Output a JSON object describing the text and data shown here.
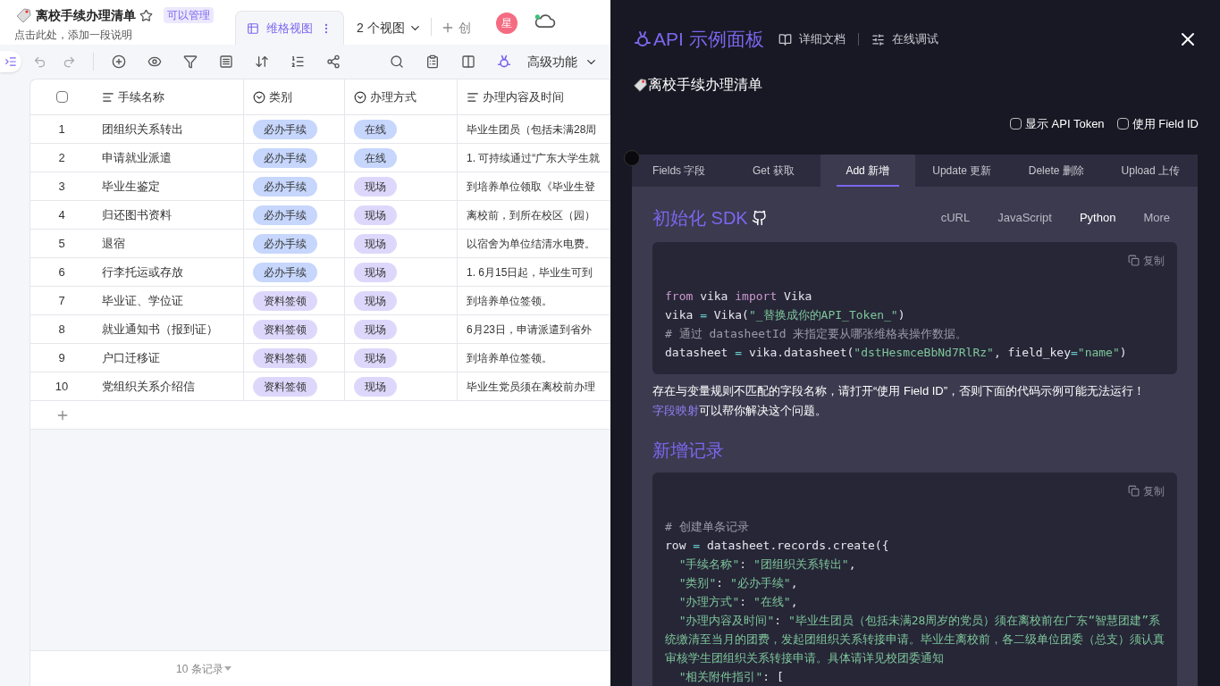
{
  "sheet": {
    "title": "离校手续办理清单",
    "permission": "可以管理",
    "description": "点击此处，添加一段说明"
  },
  "view_tab": {
    "label": "维格视图",
    "selected": true
  },
  "views_menu": {
    "label": "2 个视图"
  },
  "create_button": {
    "label": "创"
  },
  "avatar": {
    "initial": "星"
  },
  "toolbar": {
    "advanced": "高级功能"
  },
  "table": {
    "select_all": {
      "checked": false
    },
    "columns": [
      {
        "label": "手续名称",
        "kind": "text"
      },
      {
        "label": "类别",
        "kind": "select"
      },
      {
        "label": "办理方式",
        "kind": "select"
      },
      {
        "label": "办理内容及时间",
        "kind": "text"
      }
    ],
    "rows": [
      {
        "index": "1",
        "name": "团组织关系转出",
        "category": {
          "label": "必办手续",
          "color": "#c6d6fc"
        },
        "method": {
          "label": "在线",
          "color": "#c6d6fc"
        },
        "content": "毕业生团员（包括未满28周"
      },
      {
        "index": "2",
        "name": "申请就业派遣",
        "category": {
          "label": "必办手续",
          "color": "#c6d6fc"
        },
        "method": {
          "label": "在线",
          "color": "#c6d6fc"
        },
        "content": "1. 可持续通过“广东大学生就"
      },
      {
        "index": "3",
        "name": "毕业生鉴定",
        "category": {
          "label": "必办手续",
          "color": "#c6d6fc"
        },
        "method": {
          "label": "现场",
          "color": "#ddd8fb"
        },
        "content": "到培养单位领取《毕业生登"
      },
      {
        "index": "4",
        "name": "归还图书资料",
        "category": {
          "label": "必办手续",
          "color": "#c6d6fc"
        },
        "method": {
          "label": "现场",
          "color": "#ddd8fb"
        },
        "content": "离校前，到所在校区（园）"
      },
      {
        "index": "5",
        "name": "退宿",
        "category": {
          "label": "必办手续",
          "color": "#c6d6fc"
        },
        "method": {
          "label": "现场",
          "color": "#ddd8fb"
        },
        "content": "以宿舍为单位结清水电费。"
      },
      {
        "index": "6",
        "name": "行李托运或存放",
        "category": {
          "label": "必办手续",
          "color": "#c6d6fc"
        },
        "method": {
          "label": "现场",
          "color": "#ddd8fb"
        },
        "content": "1. 6月15日起，毕业生可到"
      },
      {
        "index": "7",
        "name": "毕业证、学位证",
        "category": {
          "label": "资料签领",
          "color": "#ddd8fb"
        },
        "method": {
          "label": "现场",
          "color": "#ddd8fb"
        },
        "content": "到培养单位签领。"
      },
      {
        "index": "8",
        "name": "就业通知书（报到证）",
        "category": {
          "label": "资料签领",
          "color": "#ddd8fb"
        },
        "method": {
          "label": "现场",
          "color": "#ddd8fb"
        },
        "content": "6月23日，申请派遣到省外"
      },
      {
        "index": "9",
        "name": "户口迁移证",
        "category": {
          "label": "资料签领",
          "color": "#ddd8fb"
        },
        "method": {
          "label": "现场",
          "color": "#ddd8fb"
        },
        "content": "到培养单位签领。"
      },
      {
        "index": "10",
        "name": "党组织关系介绍信",
        "category": {
          "label": "资料签领",
          "color": "#ddd8fb"
        },
        "method": {
          "label": "现场",
          "color": "#ddd8fb"
        },
        "content": "毕业生党员须在离校前办理"
      }
    ]
  },
  "record_count": "10 条记录",
  "api_panel": {
    "title": "API 示例面板",
    "links": [
      "详细文档",
      "在线调试"
    ],
    "sheet_name": "离校手续办理清单",
    "options": [
      {
        "label": "显示 API Token",
        "checked": false
      },
      {
        "label": "使用 Field ID",
        "checked": false
      }
    ],
    "tabs": [
      {
        "label": "Fields 字段",
        "selected": false
      },
      {
        "label": "Get 获取",
        "selected": false
      },
      {
        "label": "Add 新增",
        "selected": true
      },
      {
        "label": "Update 更新",
        "selected": false
      },
      {
        "label": "Delete 删除",
        "selected": false
      },
      {
        "label": "Upload 上传",
        "selected": false
      }
    ],
    "sdk_heading": "初始化 SDK",
    "languages": [
      {
        "label": "cURL",
        "selected": false
      },
      {
        "label": "JavaScript",
        "selected": false
      },
      {
        "label": "Python",
        "selected": true
      },
      {
        "label": "More",
        "selected": false
      }
    ],
    "init_copy_label": "复制",
    "add_copy_label": "复制",
    "init_code": [
      [
        {
          "kind": "kw",
          "text": "from"
        },
        {
          "kind": "plain",
          "text": " vika "
        },
        {
          "kind": "kw",
          "text": "import"
        },
        {
          "kind": "plain",
          "text": " Vika"
        }
      ],
      [
        {
          "kind": "plain",
          "text": "vika "
        },
        {
          "kind": "op",
          "text": "="
        },
        {
          "kind": "plain",
          "text": " Vika("
        },
        {
          "kind": "str",
          "text": "\"_替换成你的API_Token_\""
        },
        {
          "kind": "plain",
          "text": ")"
        }
      ],
      [
        {
          "kind": "com",
          "text": "# 通过 datasheetId 来指定要从哪张维格表操作数据。"
        }
      ],
      [
        {
          "kind": "plain",
          "text": "datasheet "
        },
        {
          "kind": "op",
          "text": "="
        },
        {
          "kind": "plain",
          "text": " vika.datasheet("
        },
        {
          "kind": "str",
          "text": "\"dstHesmceBbNd7RlRz\""
        },
        {
          "kind": "plain",
          "text": ", field_key"
        },
        {
          "kind": "op",
          "text": "="
        },
        {
          "kind": "str",
          "text": "\"name\""
        },
        {
          "kind": "plain",
          "text": ")"
        }
      ]
    ],
    "notice": "存在与变量规则不匹配的字段名称，请打开“使用 Field ID”，否则下面的代码示例可能无法运行！",
    "notice_link": "字段映射",
    "notice_tail": "可以帮你解决这个问题。",
    "add_heading": "新增记录",
    "add_code": [
      [
        {
          "kind": "com",
          "text": "# 创建单条记录"
        }
      ],
      [
        {
          "kind": "plain",
          "text": "row "
        },
        {
          "kind": "op",
          "text": "="
        },
        {
          "kind": "plain",
          "text": " datasheet.records.create({"
        }
      ],
      [
        {
          "kind": "str",
          "text": "  \"手续名称\""
        },
        {
          "kind": "plain",
          "text": ": "
        },
        {
          "kind": "str",
          "text": "\"团组织关系转出\""
        },
        {
          "kind": "plain",
          "text": ","
        }
      ],
      [
        {
          "kind": "str",
          "text": "  \"类别\""
        },
        {
          "kind": "plain",
          "text": ": "
        },
        {
          "kind": "str",
          "text": "\"必办手续\""
        },
        {
          "kind": "plain",
          "text": ","
        }
      ],
      [
        {
          "kind": "str",
          "text": "  \"办理方式\""
        },
        {
          "kind": "plain",
          "text": ": "
        },
        {
          "kind": "str",
          "text": "\"在线\""
        },
        {
          "kind": "plain",
          "text": ","
        }
      ],
      [
        {
          "kind": "str",
          "text": "  \"办理内容及时间\""
        },
        {
          "kind": "plain",
          "text": ": "
        },
        {
          "kind": "str",
          "text": "\"毕业生团员（包括未满28周岁的党员）须在离校前在广东“智慧团建”系统缴清至当月的团费，发起团组织关系转接申请。毕业生离校前，各二级单位团委（总支）须认真审核学生团组织关系转接申请。具体请详见校团委通知"
        }
      ],
      [
        {
          "kind": "str",
          "text": "  \"相关附件指引\""
        },
        {
          "kind": "plain",
          "text": ": ["
        }
      ]
    ]
  }
}
